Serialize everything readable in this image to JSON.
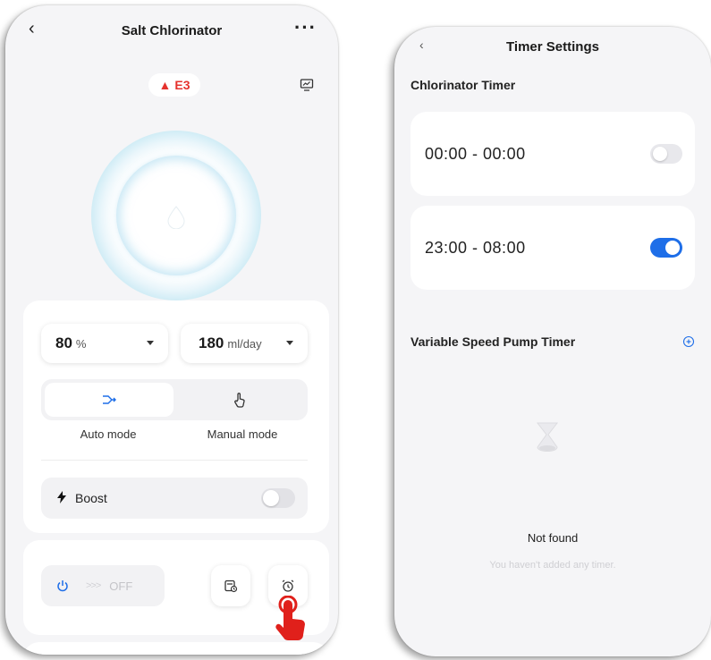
{
  "left_screen": {
    "header": {
      "back_icon": "chevron-left-icon",
      "title": "Salt Chlorinator",
      "more_label": "···"
    },
    "error_badge": {
      "icon": "warning-triangle-icon",
      "code": "E3",
      "color": "#e5322d"
    },
    "monitor_icon": "monitor-chart-icon",
    "center_icon": "water-drop-icon",
    "controls": {
      "output": {
        "value": "80",
        "unit": "%"
      },
      "dose": {
        "value": "180",
        "unit": "ml/day"
      },
      "modes": [
        {
          "label": "Auto mode",
          "icon": "flow-arrows-icon",
          "selected": true
        },
        {
          "label": "Manual mode",
          "icon": "hand-touch-icon",
          "selected": false
        }
      ],
      "boost": {
        "label": "Boost",
        "icon": "lightning-bolt-icon",
        "enabled": false
      }
    },
    "bottom": {
      "power_icon": "power-icon",
      "chevrons": ">>>",
      "state_label": "OFF",
      "schedule_icon": "calendar-clock-icon",
      "timer_icon": "alarm-clock-icon"
    },
    "accent_color": "#1e6ee8"
  },
  "right_screen": {
    "header": {
      "back_label": "‹",
      "title": "Timer Settings"
    },
    "chlorinator_section": {
      "title": "Chlorinator Timer",
      "timers": [
        {
          "range": "00:00 - 00:00",
          "enabled": false
        },
        {
          "range": "23:00 - 08:00",
          "enabled": true
        }
      ]
    },
    "pump_section": {
      "title": "Variable Speed Pump Timer",
      "add_icon": "plus-circle-icon",
      "empty_icon": "empty-box-icon",
      "empty_title": "Not found",
      "empty_subtitle": "You haven't added any timer."
    }
  }
}
